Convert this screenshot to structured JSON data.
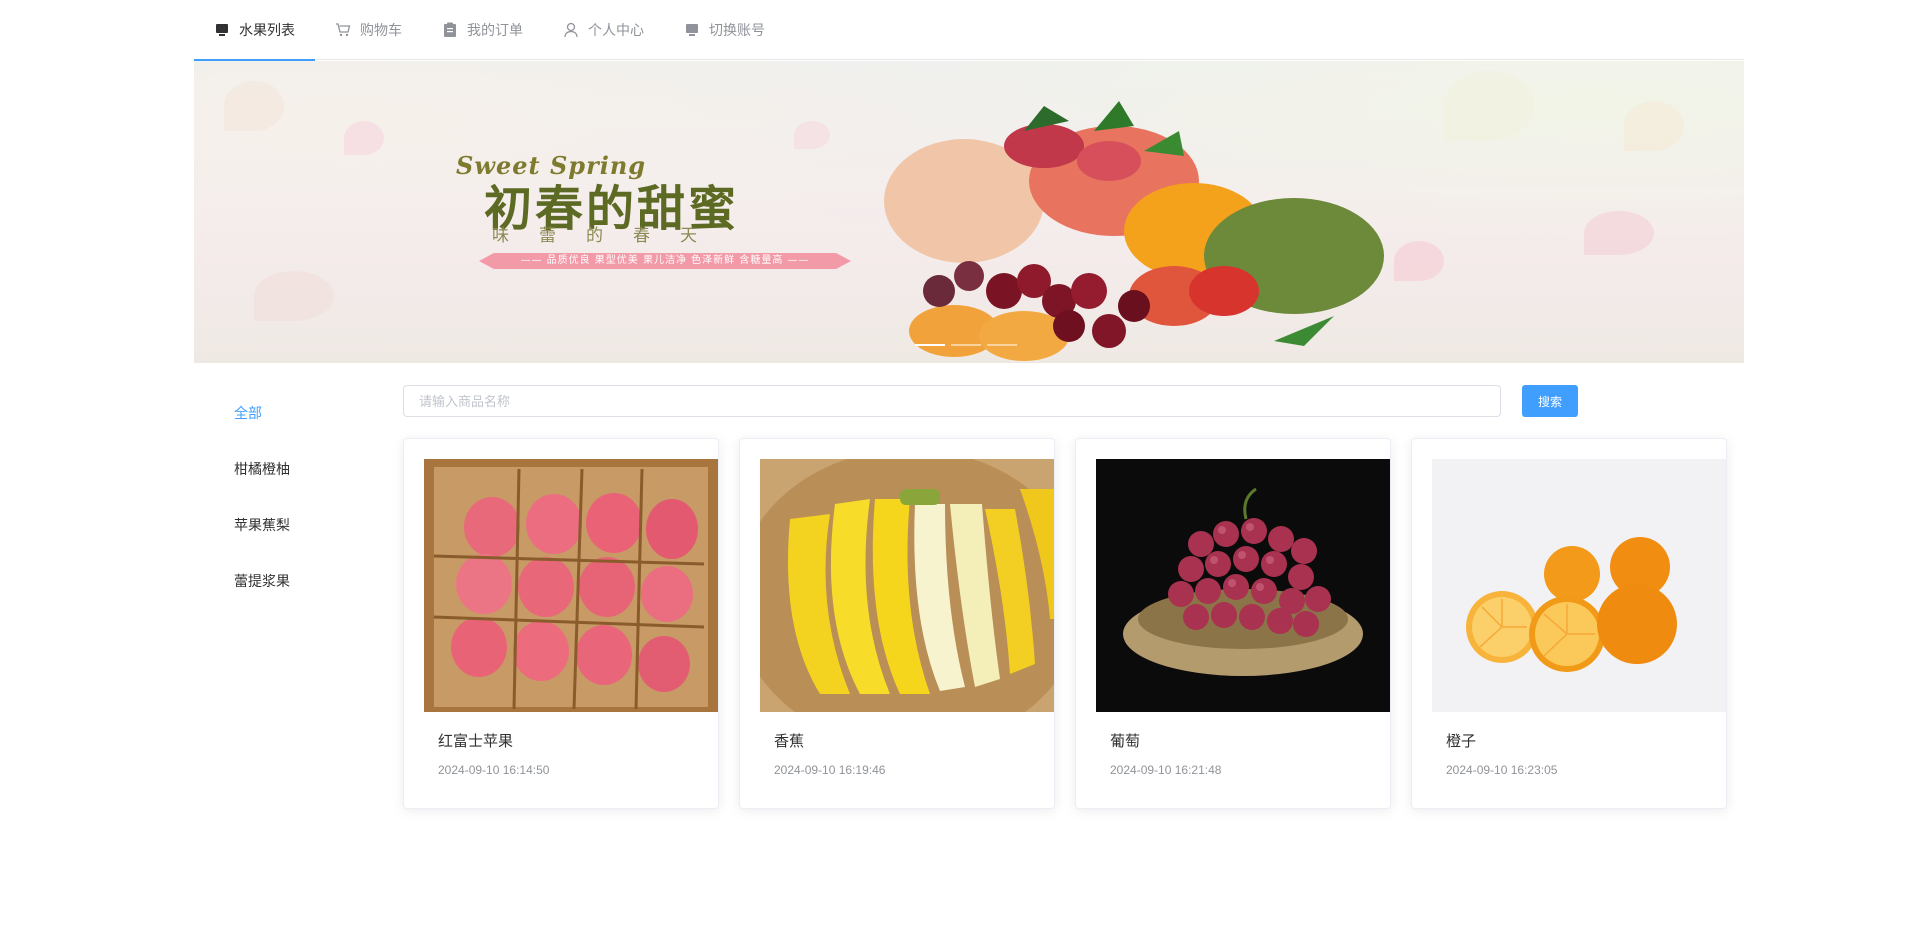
{
  "nav": {
    "items": [
      {
        "label": "水果列表",
        "icon": "monitor-icon",
        "active": true
      },
      {
        "label": "购物车",
        "icon": "cart-icon",
        "active": false
      },
      {
        "label": "我的订单",
        "icon": "clipboard-icon",
        "active": false
      },
      {
        "label": "个人中心",
        "icon": "user-icon",
        "active": false
      },
      {
        "label": "切换账号",
        "icon": "monitor-icon",
        "active": false
      }
    ]
  },
  "banner": {
    "english": "Sweet Spring",
    "title": "初春的甜蜜",
    "subtitle": "味蕾的春天",
    "ribbon": "—— 品质优良 果型优美 果儿洁净 色泽新鲜 含糖量高 ——",
    "slides": 3,
    "active_slide": 1
  },
  "sidebar": {
    "items": [
      {
        "label": "全部",
        "active": true
      },
      {
        "label": "柑橘橙柚",
        "active": false
      },
      {
        "label": "苹果蕉梨",
        "active": false
      },
      {
        "label": "蕾提浆果",
        "active": false
      }
    ]
  },
  "search": {
    "placeholder": "请输入商品名称",
    "value": "",
    "button": "搜索"
  },
  "products": [
    {
      "name": "红富士苹果",
      "time": "2024-09-10 16:14:50",
      "image": "apples-in-box"
    },
    {
      "name": "香蕉",
      "time": "2024-09-10 16:19:46",
      "image": "bananas"
    },
    {
      "name": "葡萄",
      "time": "2024-09-10 16:21:48",
      "image": "grapes"
    },
    {
      "name": "橙子",
      "time": "2024-09-10 16:23:05",
      "image": "oranges"
    }
  ],
  "colors": {
    "accent": "#409eff",
    "text": "#303133",
    "muted": "#909399"
  }
}
